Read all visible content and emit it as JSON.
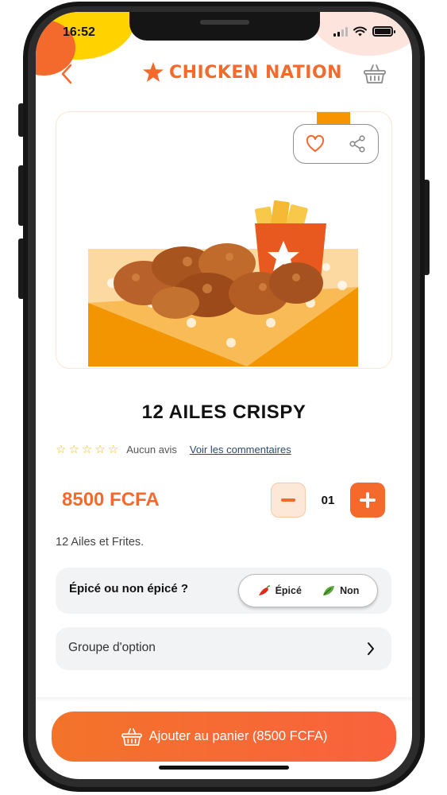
{
  "status_bar": {
    "time": "16:52"
  },
  "brand": {
    "name": "CHICKEN NATION"
  },
  "product": {
    "title": "12 AILES CRISPY",
    "rating_stars": 0,
    "rating_max": 5,
    "no_review_text": "Aucun avis",
    "see_comments_text": "Voir les commentaires",
    "price": "8500 FCFA",
    "quantity": "01",
    "description": "12 Ailes et Frites."
  },
  "spicy": {
    "question": "Épicé ou non épicé ?",
    "option_spicy": "Épicé",
    "option_mild": "Non"
  },
  "option_group": {
    "label": "Groupe d'option"
  },
  "cart": {
    "button_label": "Ajouter au panier (8500 FCFA)"
  },
  "colors": {
    "accent": "#f46a2d",
    "brand_yellow": "#ffd200",
    "option_bg": "#f2f3f5"
  },
  "icons": [
    "back-chevron-icon",
    "star-logo-icon",
    "basket-icon",
    "heart-icon",
    "share-icon",
    "minus-icon",
    "plus-icon",
    "chili-icon",
    "leaf-icon",
    "chevron-right-icon"
  ]
}
